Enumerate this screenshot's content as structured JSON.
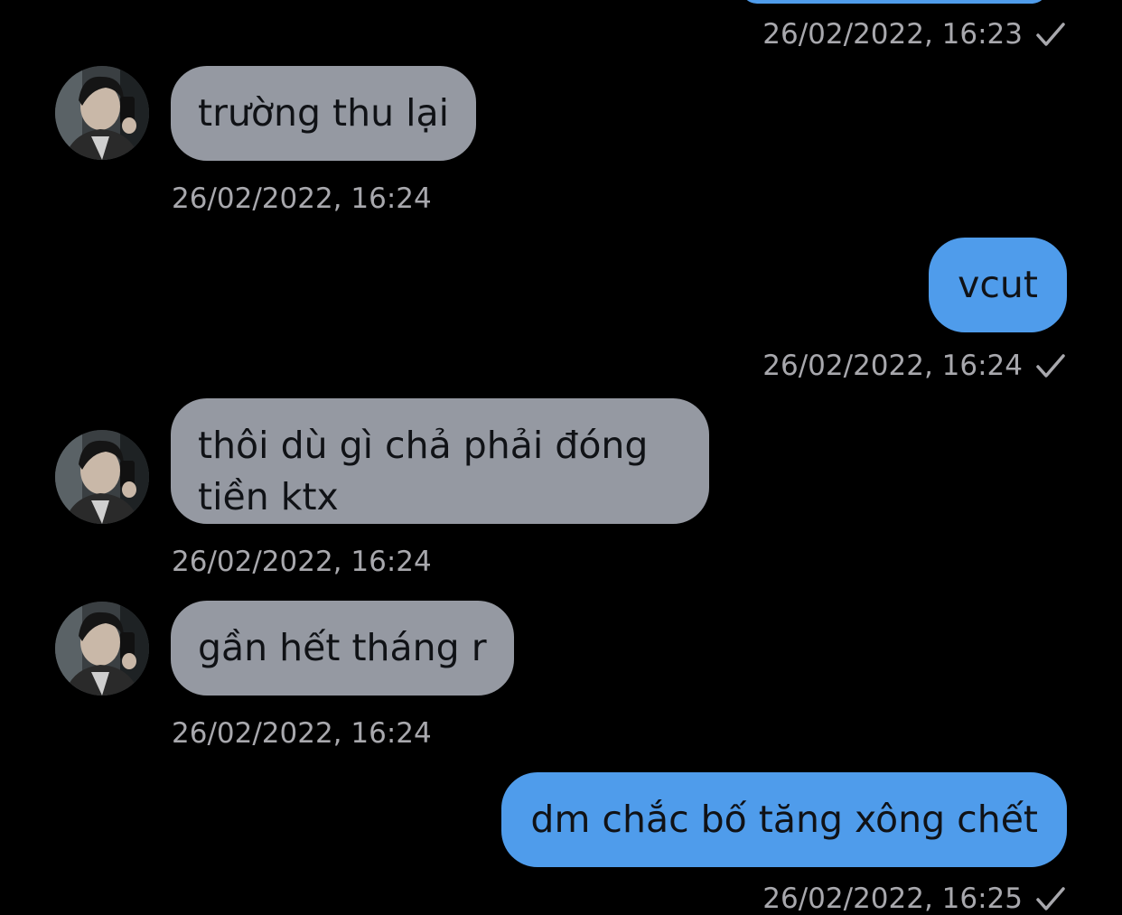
{
  "messages": [
    {
      "id": "m0",
      "direction": "outgoing",
      "text": "",
      "timestamp": "26/02/2022, 16:23",
      "status": "sent"
    },
    {
      "id": "m1",
      "direction": "incoming",
      "text": "trường thu lại",
      "timestamp": "26/02/2022, 16:24"
    },
    {
      "id": "m2",
      "direction": "outgoing",
      "text": "vcut",
      "timestamp": "26/02/2022, 16:24",
      "status": "sent"
    },
    {
      "id": "m3",
      "direction": "incoming",
      "text": "thôi dù gì chả phải đóng tiền ktx",
      "timestamp": "26/02/2022, 16:24"
    },
    {
      "id": "m4",
      "direction": "incoming",
      "text": "gần hết tháng r",
      "timestamp": "26/02/2022, 16:24"
    },
    {
      "id": "m5",
      "direction": "outgoing",
      "text": "dm chắc bố tăng xông chết",
      "timestamp": "26/02/2022, 16:25",
      "status": "sent"
    }
  ],
  "colors": {
    "background": "#000000",
    "incoming_bubble": "#9599a2",
    "outgoing_bubble": "#4f9ceb",
    "timestamp": "#a8a8ad",
    "bubble_text": "#101216"
  },
  "icons": {
    "sent_status": "checkmark-icon",
    "contact_avatar": "avatar"
  }
}
